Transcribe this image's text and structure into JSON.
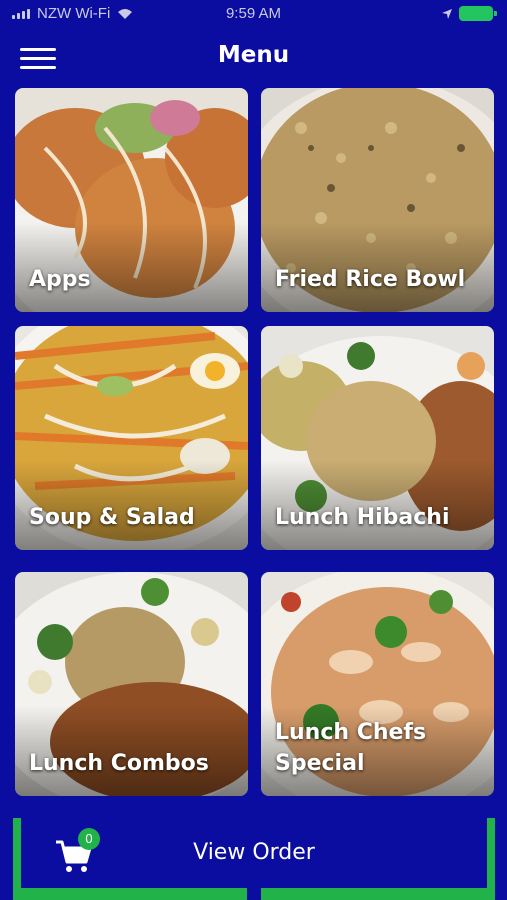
{
  "status_bar": {
    "carrier": "NZW Wi-Fi",
    "time": "9:59 AM"
  },
  "header": {
    "title": "Menu",
    "menu_icon": "hamburger-menu-icon"
  },
  "categories": [
    {
      "label": "Apps"
    },
    {
      "label": "Fried Rice Bowl"
    },
    {
      "label": "Soup & Salad"
    },
    {
      "label": "Lunch Hibachi"
    },
    {
      "label": "Lunch Combos"
    },
    {
      "label": "Lunch Chefs\nSpecial"
    }
  ],
  "footer": {
    "view_order_label": "View Order",
    "cart_count": "0",
    "cart_icon": "shopping-cart-icon"
  },
  "colors": {
    "background": "#0b0ca0",
    "accent_green": "#22b24a",
    "battery_green": "#22c55e"
  }
}
